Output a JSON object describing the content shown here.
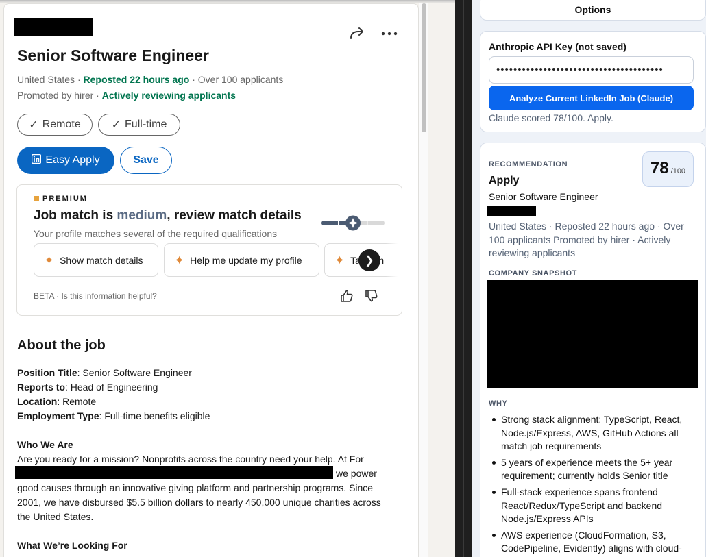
{
  "linkedin": {
    "job_title": "Senior Software Engineer",
    "meta_location": "United States",
    "meta_sep": " · ",
    "meta_reposted": "Repost­ed 22 hours ago",
    "meta_applicants": " · Over 100 applicants",
    "meta_promoted": "Promoted by hirer",
    "meta_reviewing": "Actively reviewing applicants",
    "pills": [
      "Remote",
      "Full-time"
    ],
    "easy_apply_label": "Easy Apply",
    "save_label": "Save",
    "premium": {
      "badge": "PREMIUM",
      "headline_prefix": "Job match is ",
      "headline_level": "medium",
      "headline_suffix": ", review match details",
      "subtext": "Your profile matches several of the required qualifications",
      "chips": [
        "Show match details",
        "Help me update my profile",
        "Tailor m"
      ],
      "beta_text": "BETA · Is this information helpful?"
    },
    "about": {
      "heading": "About the job",
      "position_label": "Position Title",
      "position_value": ": Senior Software Engineer",
      "reports_label": "Reports to",
      "reports_value": ": Head of Engineering",
      "location_label": "Location",
      "location_value": ": Remote",
      "employment_label": "Employment Type",
      "employment_value": ": Full-time benefits eligible",
      "who_heading": "Who We Are",
      "who_line1": "Are you ready for a mission? Nonprofits across the country need your help. At For",
      "who_line2_tail": "we power",
      "who_line3": "good causes through an innovative giving platform and partnership programs. Since",
      "who_line4": "2001, we have disbursed $5.5 billion dollars to nearly 450,000 unique charities across",
      "who_line5": "the United States.",
      "looking_heading": "What We’re Looking For"
    }
  },
  "extension": {
    "options_title": "Options",
    "api_label": "Anthropic API Key (not saved)",
    "api_masked": "•••••••••••••••••••••••••••••••••••••••",
    "analyze_label": "Analyze Current LinkedIn Job (Claude)",
    "status": "Claude scored 78/100. Apply.",
    "recommendation_label": "RECOMMENDATION",
    "recommendation_value": "Apply",
    "score": "78",
    "score_denominator": "/100",
    "job_title": "Senior Software Engineer",
    "job_meta": "United States · Reposted 22 hours ago · Over 100 applicants Promoted by hirer · Actively reviewing applicants",
    "company_snapshot_label": "COMPANY SNAPSHOT",
    "why_label": "WHY",
    "why_items": [
      "Strong stack alignment: TypeScript, React, Node.js/Express, AWS, GitHub Actions all match job requirements",
      "5 years of experience meets the 5+ year requirement; currently holds Senior title",
      "Full-stack experience spans frontend React/Redux/TypeScript and backend Node.js/Express APIs",
      "AWS experience (CloudFormation, S3, CodePipeline, Evidently) aligns with cloud-"
    ]
  },
  "colors": {
    "linkedin_blue": "#0a66c2",
    "linkedin_green": "#01754f",
    "extension_button": "#0a66ee",
    "premium_gold": "#e7a33e"
  }
}
